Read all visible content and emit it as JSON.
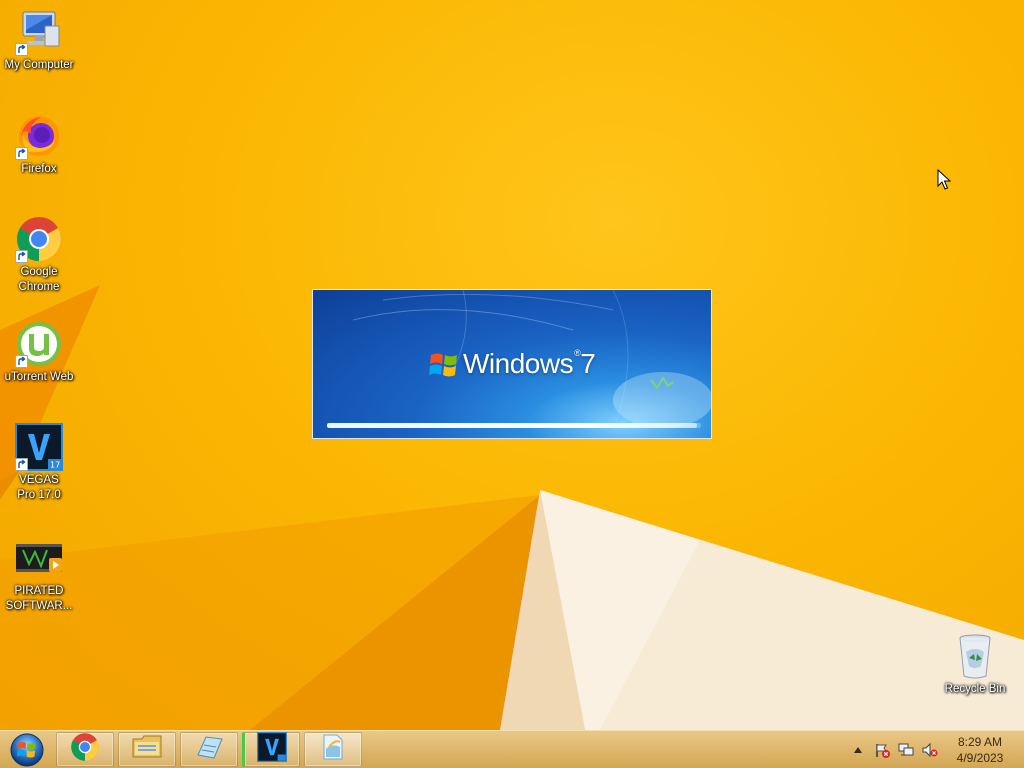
{
  "desktop": {
    "icons": [
      {
        "label": "My Computer",
        "icon": "computer-icon"
      },
      {
        "label": "Firefox",
        "icon": "firefox-icon"
      },
      {
        "label": "Google Chrome",
        "icon": "chrome-icon"
      },
      {
        "label": "uTorrent Web",
        "icon": "utorrent-icon"
      },
      {
        "label": "VEGAS Pro 17.0",
        "icon": "vegas-icon"
      },
      {
        "label": "PIRATED SOFTWAR...",
        "icon": "video-file-icon"
      },
      {
        "label": "Recycle Bin",
        "icon": "recycle-bin-icon"
      }
    ]
  },
  "splash": {
    "title": "Windows",
    "version": "7",
    "progress": 0.99
  },
  "taskbar": {
    "apps": [
      {
        "name": "Google Chrome",
        "icon": "chrome-icon"
      },
      {
        "name": "File Explorer",
        "icon": "folder-icon"
      },
      {
        "name": "Notepad",
        "icon": "notepad-icon"
      },
      {
        "name": "VEGAS Pro 17.0",
        "icon": "vegas-icon"
      },
      {
        "name": "Document",
        "icon": "document-icon"
      }
    ],
    "clock": {
      "time": "8:29 AM",
      "date": "4/9/2023"
    }
  },
  "colors": {
    "wallpaper": "#f7b300",
    "taskbar": "#dfb66c",
    "splash_blue": "#1a63c4",
    "vegas": "#1d6fb6"
  }
}
